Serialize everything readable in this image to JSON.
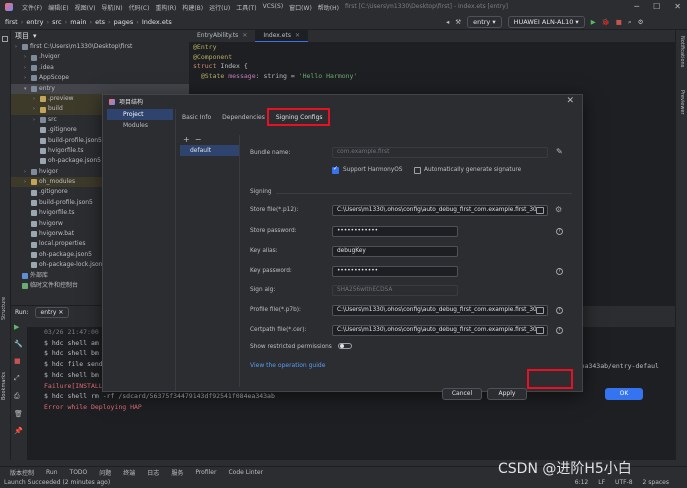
{
  "titlebar": {
    "menu": [
      "文件(F)",
      "编辑(E)",
      "视图(V)",
      "导航(N)",
      "代码(C)",
      "重构(R)",
      "构建(B)",
      "运行(U)",
      "工具(T)",
      "VCS(S)",
      "窗口(W)",
      "帮助(H)"
    ],
    "window_title": "first [C:\\Users\\m1330\\Desktop\\first] - Index.ets [entry]"
  },
  "navbar": {
    "crumbs": [
      "first",
      "entry",
      "src",
      "main",
      "ets",
      "pages",
      "Index.ets"
    ],
    "run_config": "entry",
    "device": "HUAWEI ALN-AL10"
  },
  "project": {
    "header": "项目",
    "tree": [
      {
        "label": "first  C:\\Users\\m1330\\Desktop\\first",
        "indent": 0,
        "kind": "folder"
      },
      {
        "label": ".hvigor",
        "indent": 1,
        "kind": "folder"
      },
      {
        "label": ".idea",
        "indent": 1,
        "kind": "folder"
      },
      {
        "label": "AppScope",
        "indent": 1,
        "kind": "folder"
      },
      {
        "label": "entry",
        "indent": 1,
        "kind": "folder-open",
        "state": "selected"
      },
      {
        "label": ".preview",
        "indent": 2,
        "kind": "folder",
        "state": "highlight"
      },
      {
        "label": "build",
        "indent": 2,
        "kind": "folder",
        "state": "highlight"
      },
      {
        "label": "src",
        "indent": 2,
        "kind": "folder"
      },
      {
        "label": ".gitignore",
        "indent": 2,
        "kind": "file"
      },
      {
        "label": "build-profile.json5",
        "indent": 2,
        "kind": "file"
      },
      {
        "label": "hvigorfile.ts",
        "indent": 2,
        "kind": "file"
      },
      {
        "label": "oh-package.json5",
        "indent": 2,
        "kind": "file"
      },
      {
        "label": "hvigor",
        "indent": 1,
        "kind": "folder"
      },
      {
        "label": "oh_modules",
        "indent": 1,
        "kind": "folder",
        "state": "highlight"
      },
      {
        "label": ".gitignore",
        "indent": 1,
        "kind": "file"
      },
      {
        "label": "build-profile.json5",
        "indent": 1,
        "kind": "file"
      },
      {
        "label": "hvigorfile.ts",
        "indent": 1,
        "kind": "file"
      },
      {
        "label": "hvigorw",
        "indent": 1,
        "kind": "file"
      },
      {
        "label": "hvigorw.bat",
        "indent": 1,
        "kind": "file"
      },
      {
        "label": "local.properties",
        "indent": 1,
        "kind": "file"
      },
      {
        "label": "oh-package.json5",
        "indent": 1,
        "kind": "file"
      },
      {
        "label": "oh-package-lock.json5",
        "indent": 1,
        "kind": "file"
      },
      {
        "label": "外部库",
        "indent": 0,
        "kind": "lib"
      },
      {
        "label": "临时文件和控制台",
        "indent": 0,
        "kind": "scratch"
      }
    ]
  },
  "editor": {
    "tabs": [
      "EntryAbility.ts",
      "Index.ets"
    ],
    "active_tab": 1,
    "code": [
      [
        {
          "t": "@Entry",
          "c": "#b3ae60"
        }
      ],
      [
        {
          "t": "@Component",
          "c": "#b3ae60"
        }
      ],
      [
        {
          "t": "struct ",
          "c": "#cf8e6d"
        },
        {
          "t": "Index ",
          "c": "#bcbec4"
        },
        {
          "t": "{",
          "c": "#bcbec4"
        }
      ],
      [
        {
          "t": "  @State ",
          "c": "#b3ae60"
        },
        {
          "t": "message",
          "c": "#c77dbb"
        },
        {
          "t": ": string = ",
          "c": "#bcbec4"
        },
        {
          "t": "'Hello Harmony'",
          "c": "#6aab73"
        }
      ]
    ]
  },
  "run": {
    "label": "Run:",
    "config": "entry",
    "console": [
      {
        "text": "03/26 21:47:00 ...",
        "type": "dim"
      },
      {
        "text": "$ hdc shell am ...",
        "type": "normal"
      },
      {
        "text": "$ hdc shell bm ...",
        "type": "normal"
      },
      {
        "text": "$ hdc file send ...",
        "type": "normal"
      },
      {
        "text": "$ hdc shell bm ...",
        "type": "normal"
      },
      {
        "text": "Failure[INSTALL...",
        "type": "err"
      },
      {
        "text": "$ hdc shell rm -rf /sdcard/56375f34479143df92541f084ea343ab",
        "type": "normal"
      },
      {
        "text": "Error while Deploying HAP",
        "type": "err"
      }
    ],
    "console_tail": "f084ea343ab/entry-defaul"
  },
  "toolstrip": [
    "版本控制",
    "Run",
    "TODO",
    "问题",
    "终端",
    "日志",
    "服务",
    "Profiler",
    "Code Linter"
  ],
  "statusbar": {
    "left": "Launch Succeeded (2 minutes ago)",
    "right": [
      "6:12",
      "LF",
      "UTF-8",
      "2 spaces"
    ]
  },
  "right_stripe": [
    "Notifications",
    "Previewer"
  ],
  "left_stripe": [
    "Bookmarks",
    "Structure"
  ],
  "dialog": {
    "title": "项目结构",
    "nav": [
      "Project",
      "Modules"
    ],
    "active_nav": 0,
    "tabs": [
      "Basic Info",
      "Dependencies",
      "Signing Configs"
    ],
    "active_tab": 2,
    "configs": [
      "default"
    ],
    "bundle_name_label": "Bundle name:",
    "bundle_name_value": "com.example.first",
    "support_harmonyos": {
      "label": "Support HarmonyOS",
      "checked": true
    },
    "auto_sign": {
      "label": "Automatically generate signature",
      "checked": false
    },
    "signing_section": "Signing",
    "fields": [
      {
        "label": "Store file(*.p12):",
        "value": "C:\\Users\\m1330\\.ohos\\config\\auto_debug_first_com.example.first_30",
        "type": "file",
        "side": "fingerprint"
      },
      {
        "label": "Store password:",
        "value": "••••••••••••",
        "type": "text",
        "side": "help"
      },
      {
        "label": "Key alias:",
        "value": "debugKey",
        "type": "text",
        "side": "none"
      },
      {
        "label": "Key password:",
        "value": "••••••••••••",
        "type": "text",
        "side": "help"
      },
      {
        "label": "Sign alg:",
        "value": "SHA256withECDSA",
        "type": "disabled",
        "side": "none"
      },
      {
        "label": "Profile file(*.p7b):",
        "value": "C:\\Users\\m1330\\.ohos\\config\\auto_debug_first_com.example.first_30",
        "type": "file",
        "side": "help"
      },
      {
        "label": "Certpath file(*.cer):",
        "value": "C:\\Users\\m1330\\.ohos\\config\\auto_debug_first_com.example.first_30",
        "type": "file",
        "side": "help"
      }
    ],
    "show_restricted_label": "Show restricted permissions",
    "view_guide": "View the operation guide",
    "buttons": {
      "cancel": "Cancel",
      "apply": "Apply",
      "ok": "OK"
    }
  },
  "watermark": "CSDN @进阶H5小白",
  "colors": {
    "accent": "#3574f0",
    "highlight_box": "#e81123",
    "error": "#e06c75",
    "link": "#589df6"
  }
}
